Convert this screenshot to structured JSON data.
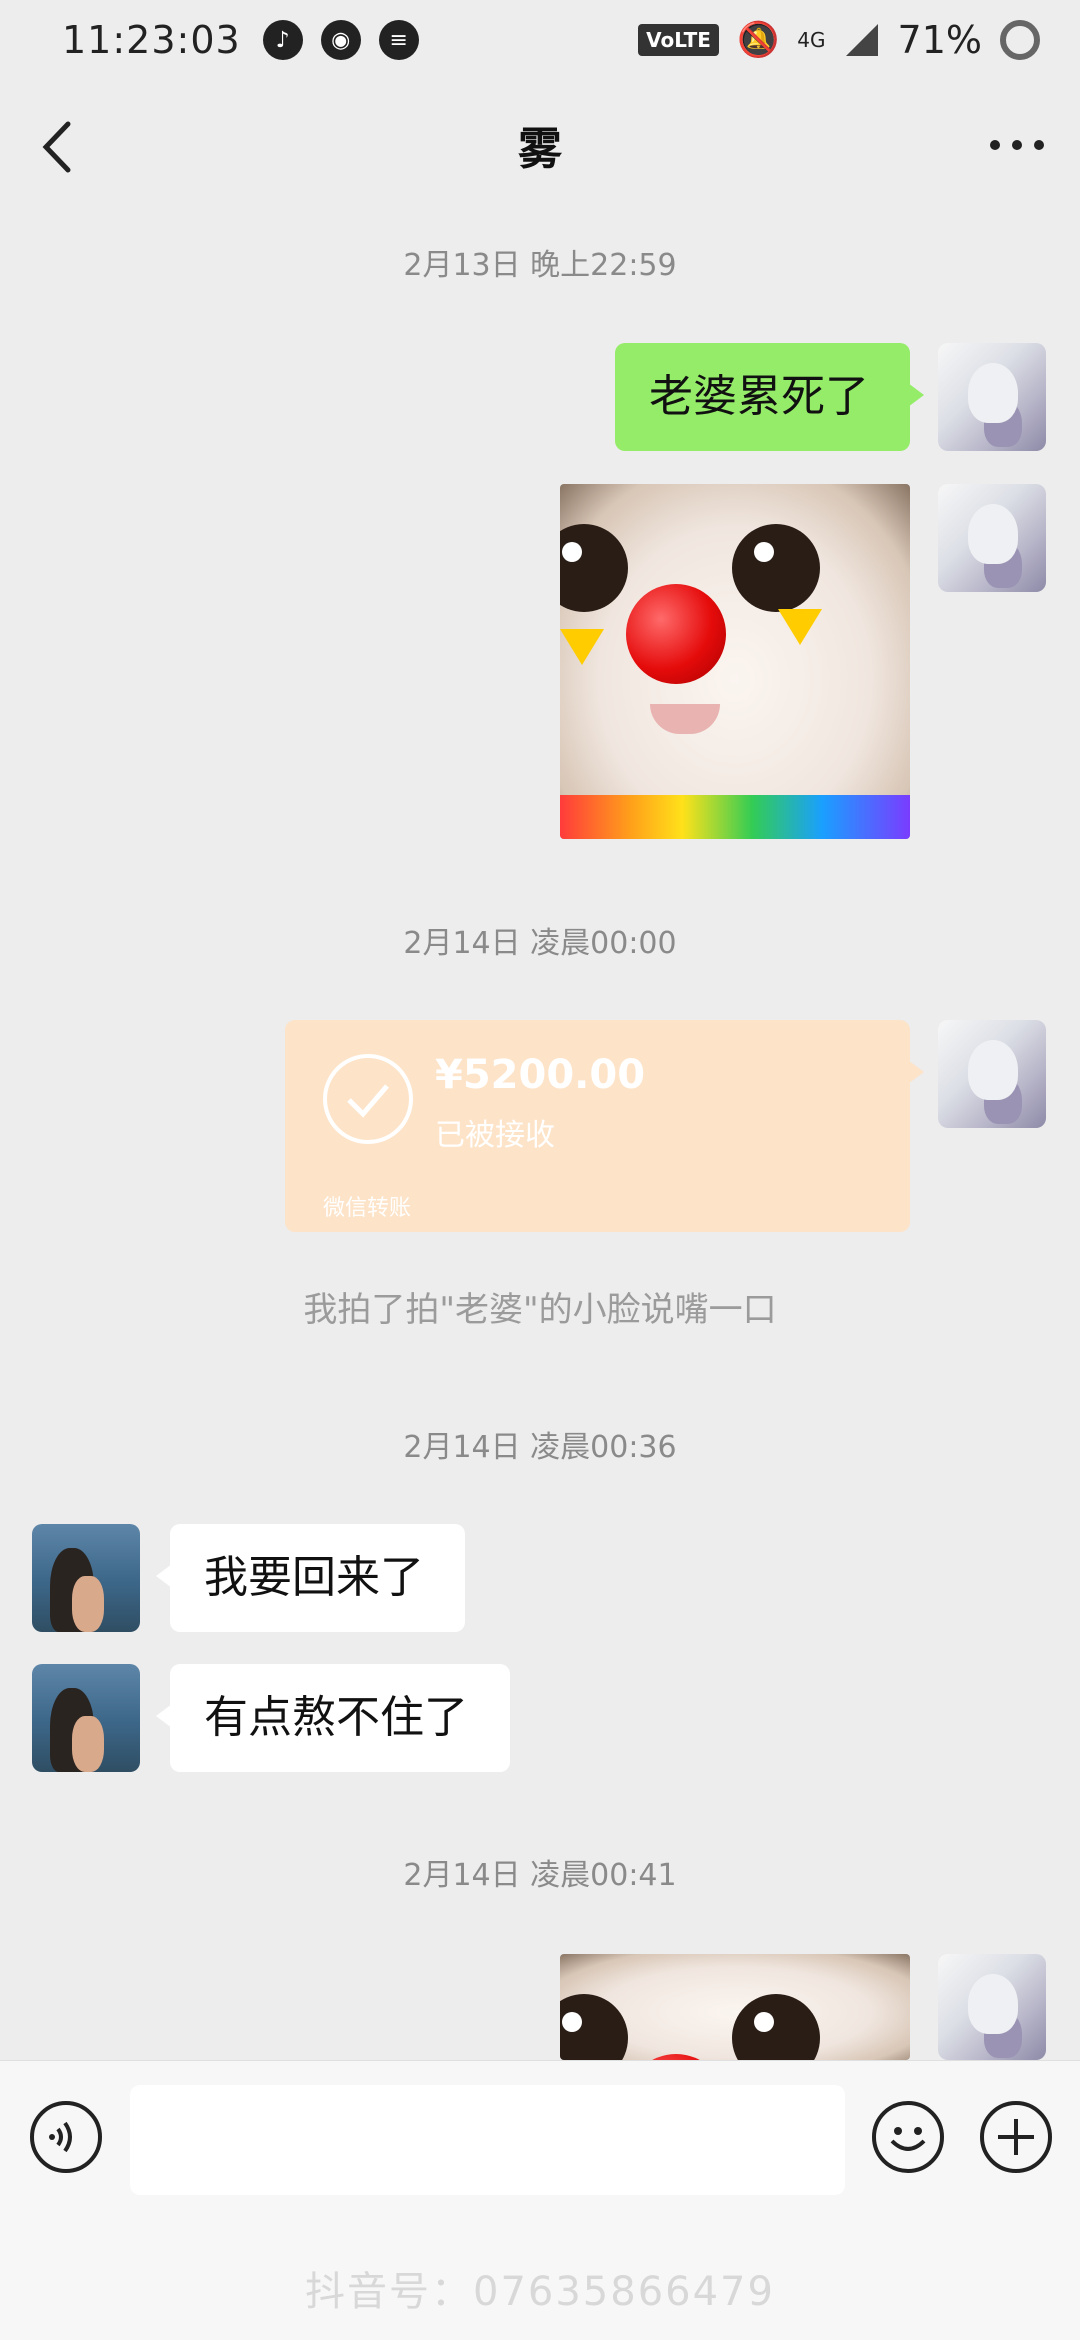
{
  "status_bar": {
    "time": "11:23:03",
    "volte": "VoLTE",
    "network": "4G",
    "battery": "71%"
  },
  "header": {
    "title": "雾"
  },
  "messages": {
    "ts1": "2月13日 晚上22:59",
    "msg1": "老婆累死了",
    "ts2": "2月14日 凌晨00:00",
    "transfer_amount": "¥5200.00",
    "transfer_status": "已被接收",
    "transfer_footer": "微信转账",
    "pat_message": "我拍了拍\"老婆\"的小脸说嘴一口",
    "ts3": "2月14日 凌晨00:36",
    "msg2": "我要回来了",
    "msg3": "有点熬不住了",
    "ts4": "2月14日 凌晨00:41"
  },
  "watermark": "抖音号：07635866479"
}
